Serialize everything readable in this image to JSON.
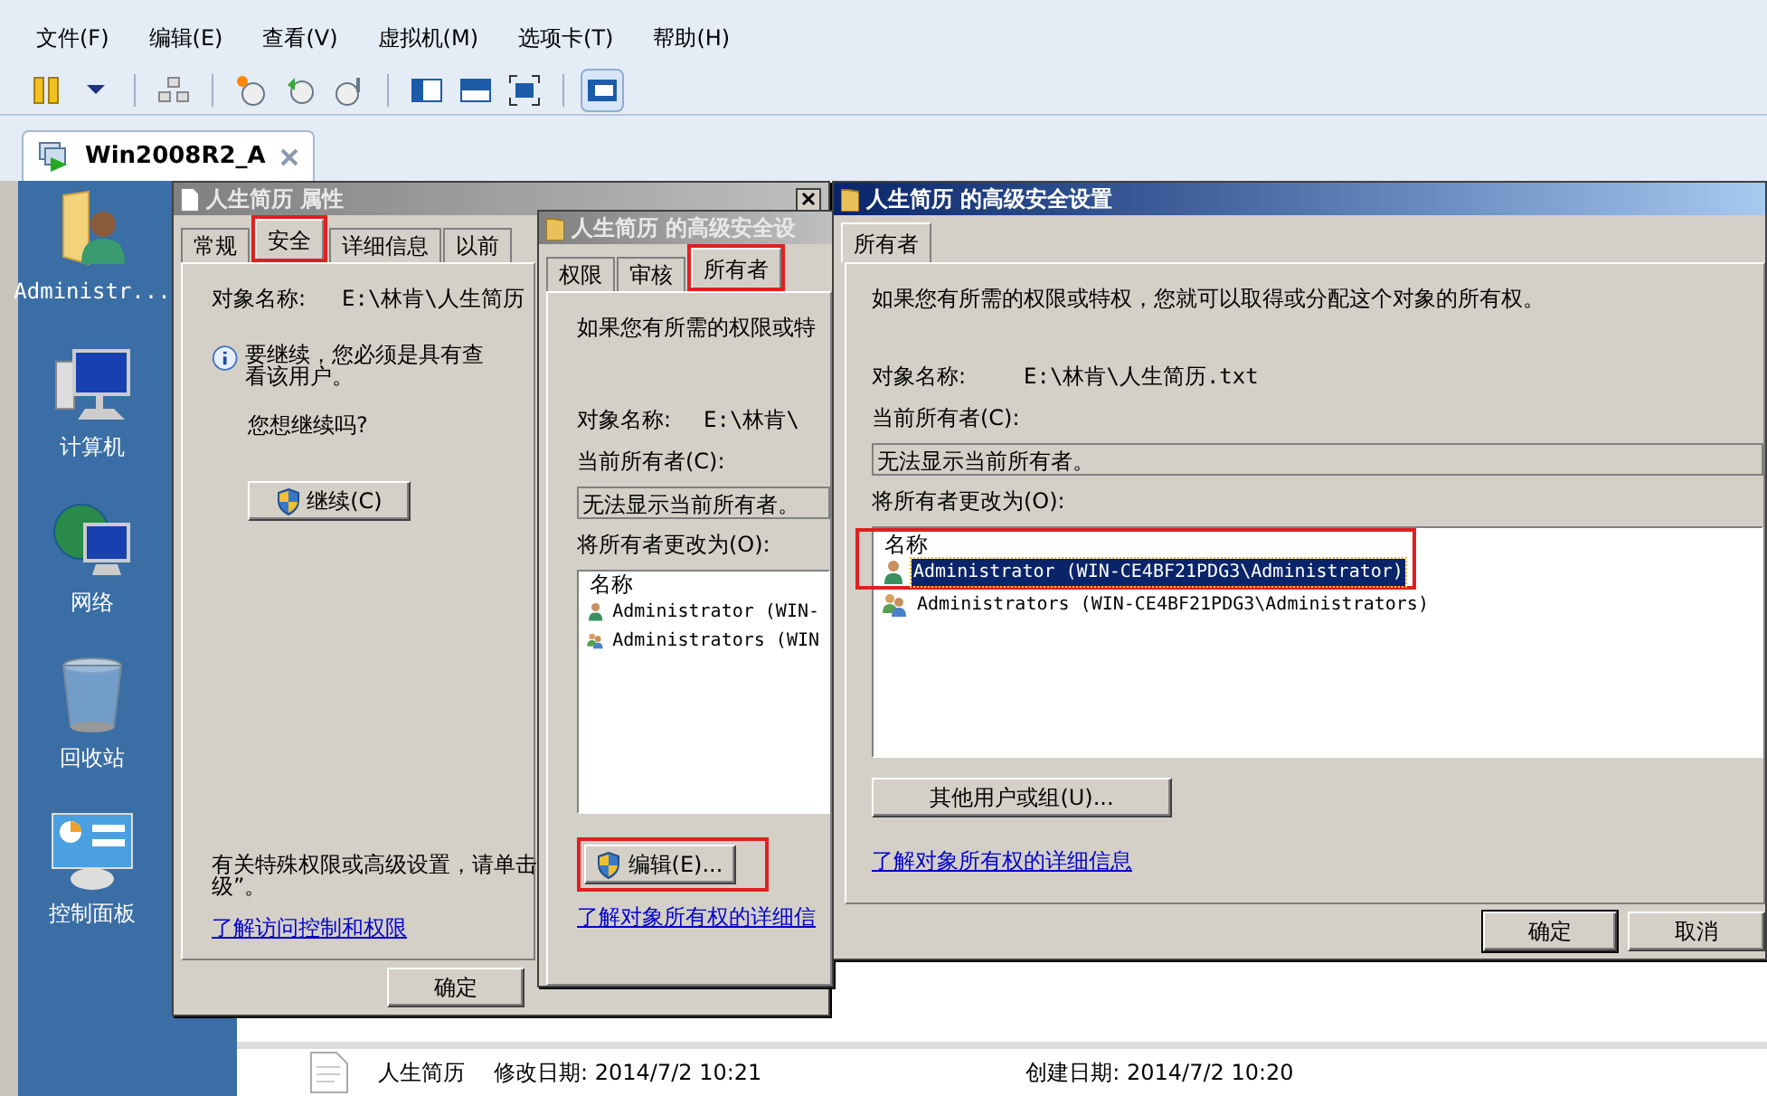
{
  "menu": [
    "文件(F)",
    "编辑(E)",
    "查看(V)",
    "虚拟机(M)",
    "选项卡(T)",
    "帮助(H)"
  ],
  "toolbar": [
    {
      "selected": false
    },
    {
      "selected": false
    },
    {
      "selected": false
    },
    {
      "selected": false
    },
    {
      "selected": false
    },
    {
      "selected": false
    },
    {
      "selected": false
    },
    {
      "selected": false
    },
    {
      "selected": false
    },
    {
      "selected": true
    }
  ],
  "vm_tab": {
    "label": "Win2008R2_A",
    "selected": true
  },
  "desktop_icons": [
    {
      "label": "Administr..."
    },
    {
      "label": "计算机"
    },
    {
      "label": "网络"
    },
    {
      "label": "回收站"
    },
    {
      "label": "控制面板"
    }
  ],
  "properties_dialog": {
    "title": "人生简历 属性",
    "active": false,
    "tabs": [
      {
        "label": "常规",
        "selected": false,
        "highlighted": false
      },
      {
        "label": "安全",
        "selected": true,
        "highlighted": true
      },
      {
        "label": "详细信息",
        "selected": false,
        "highlighted": false
      },
      {
        "label": "以前",
        "selected": false,
        "highlighted": false
      }
    ],
    "object_label": "对象名称:",
    "object_value": "E:\\林肯\\人生简历",
    "info_text": "要继续，您必须是具有查看该用户。",
    "question": "您想继续吗?",
    "continue_button": "继续(C)",
    "special_text": "有关特殊权限或高级设置，请单击级”。",
    "link": "了解访问控制和权限",
    "ok_button": "确定"
  },
  "advanced_dialog_back": {
    "title": "人生简历 的高级安全设",
    "active": false,
    "tabs": [
      {
        "label": "权限",
        "selected": false,
        "highlighted": false
      },
      {
        "label": "审核",
        "selected": false,
        "highlighted": false
      },
      {
        "label": "所有者",
        "selected": true,
        "highlighted": true
      }
    ],
    "intro": "如果您有所需的权限或特",
    "object_label": "对象名称:",
    "object_value": "E:\\林肯\\",
    "current_owner_label": "当前所有者(C):",
    "current_owner_value": "无法显示当前所有者。",
    "change_label": "将所有者更改为(O):",
    "list_header": "名称",
    "owners": [
      {
        "name": "Administrator (WIN-",
        "kind": "user",
        "selected": false
      },
      {
        "name": "Administrators (WIN",
        "kind": "group",
        "selected": false
      }
    ],
    "edit_button": {
      "label": "编辑(E)...",
      "highlighted": true
    },
    "link": "了解对象所有权的详细信"
  },
  "advanced_dialog_front": {
    "title": "人生简历 的高级安全设置",
    "active": true,
    "tabs": [
      {
        "label": "所有者",
        "selected": true,
        "highlighted": false
      }
    ],
    "intro": "如果您有所需的权限或特权，您就可以取得或分配这个对象的所有权。",
    "object_label": "对象名称:",
    "object_value": "E:\\林肯\\人生简历.txt",
    "current_owner_label": "当前所有者(C):",
    "current_owner_value": "无法显示当前所有者。",
    "change_label": "将所有者更改为(O):",
    "list_header": "名称",
    "list_highlighted": true,
    "owners": [
      {
        "name": "Administrator (WIN-CE4BF21PDG3\\Administrator)",
        "kind": "user",
        "selected": true
      },
      {
        "name": "Administrators (WIN-CE4BF21PDG3\\Administrators)",
        "kind": "group",
        "selected": false
      }
    ],
    "other_button": "其他用户或组(U)...",
    "link": "了解对象所有权的详细信息",
    "ok_button": "确定",
    "cancel_button": "取消"
  },
  "explorer_row": {
    "name": "人生简历",
    "modified": "修改日期: 2014/7/2 10:21",
    "created": "创建日期: 2014/7/2 10:20"
  }
}
